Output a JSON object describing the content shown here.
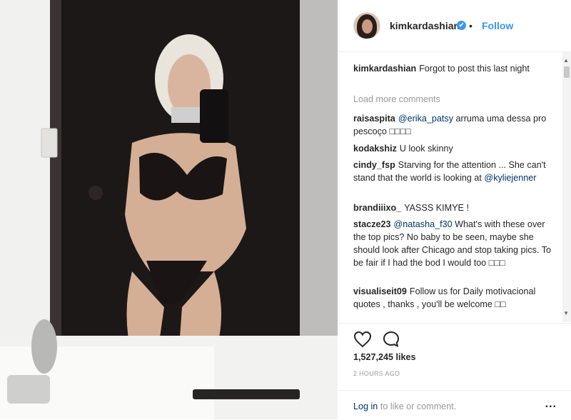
{
  "header": {
    "username": "kimkardashian",
    "verified_mark": "✔",
    "dot": "•",
    "follow_label": "Follow"
  },
  "caption": {
    "user": "kimkardashian",
    "text": "Forgot to post this last night"
  },
  "load_more": "Load more comments",
  "comments": [
    {
      "user": "raisaspita",
      "mention": "@erika_patsy",
      "text": " arruma uma dessa pro pescoço □□□□"
    },
    {
      "user": "kodakshiz",
      "mention": "",
      "text": "U look skinny"
    },
    {
      "user": "cindy_fsp",
      "mention": "",
      "text": "Starving for the attention ... She can't stand that the world is looking at ",
      "mention_end": "@kyliejenner"
    },
    {
      "user": "brandiiixo_",
      "mention": "",
      "text": "YASSS KIMYE !"
    },
    {
      "user": "stacze23",
      "mention": "@natasha_f30",
      "text": " What's with these over the top pics? No baby to be seen, maybe she should look after Chicago and stop taking pics. To be fair if I had the bod I would too □□□"
    },
    {
      "user": "visualiseit09",
      "mention": "",
      "text": "Follow us for Daily motivacional quotes , thanks , you'll be welcome □□"
    }
  ],
  "actions": {
    "like_icon": "heart-icon",
    "comment_icon": "comment-icon"
  },
  "likes": "1,527,245 likes",
  "time": "2 HOURS AGO",
  "footer": {
    "login_link": "Log in",
    "login_rest": " to like or comment.",
    "more": "..."
  },
  "colors": {
    "accent": "#3897f0",
    "link": "#003569",
    "muted": "#999999"
  }
}
